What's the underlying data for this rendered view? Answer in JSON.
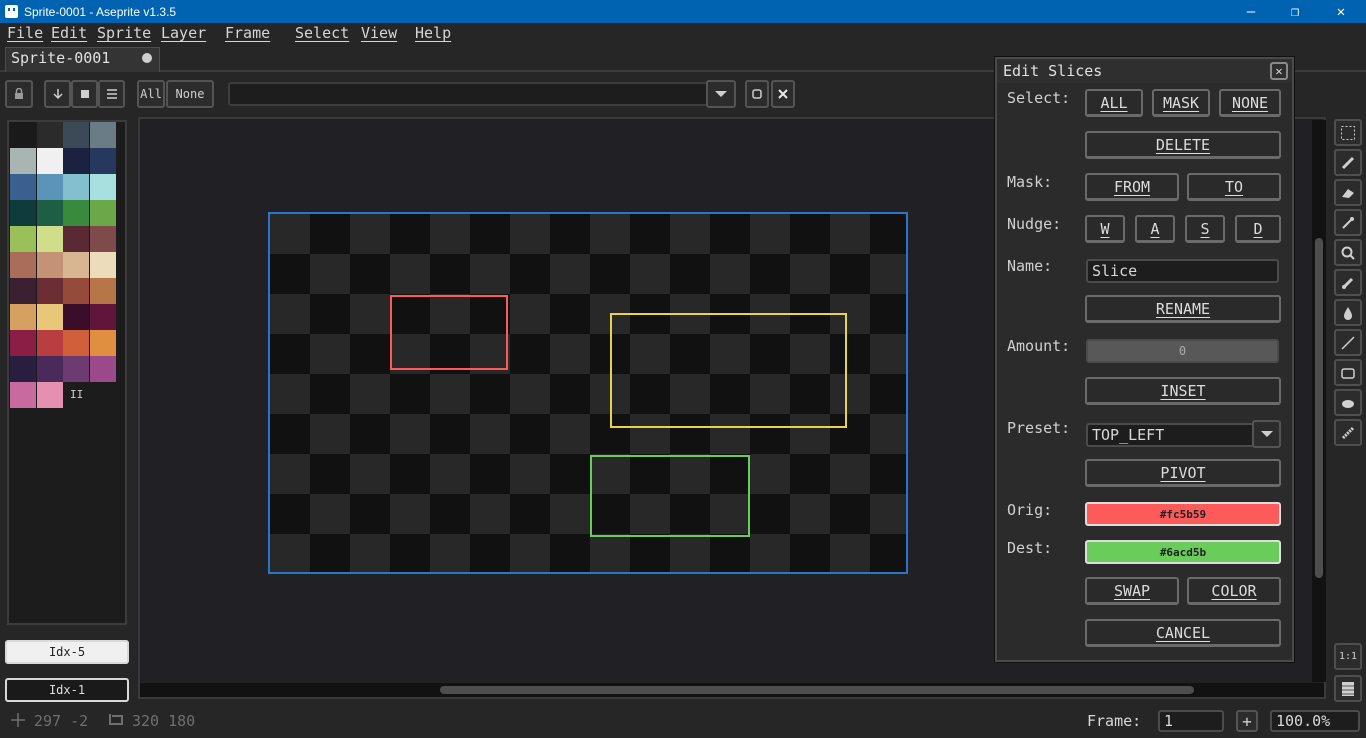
{
  "window": {
    "title": "Sprite-0001 - Aseprite v1.3.5",
    "minimize": "—",
    "restore": "❐",
    "close": "✕"
  },
  "menu": [
    "File",
    "Edit",
    "Sprite",
    "Layer",
    "Frame",
    "Select",
    "View",
    "Help"
  ],
  "tab": {
    "label": "Sprite-0001"
  },
  "toolbar": {
    "all_label": "All",
    "none_label": "None"
  },
  "palette": {
    "colors": [
      "#1a1a1a",
      "#2b2b2b",
      "#3b4a56",
      "#6a7c85",
      "#a8b5b2",
      "#f0f0f0",
      "#1b2240",
      "#27385f",
      "#3a6090",
      "#5a94b8",
      "#82c0d0",
      "#a8e0e0",
      "#0e3c3c",
      "#1e5e44",
      "#3a8a3e",
      "#6aa84a",
      "#9ac05a",
      "#d0de8a",
      "#5a2a34",
      "#7e4a4a",
      "#a86e5a",
      "#c49274",
      "#d8b692",
      "#ecdcbc",
      "#3a2030",
      "#6a2e34",
      "#964a3a",
      "#b67648",
      "#d6a060",
      "#e8c878",
      "#3a0e2a",
      "#60163a",
      "#8a1e44",
      "#b83e42",
      "#d0603a",
      "#e08e40",
      "#2a1e40",
      "#4a2a5a",
      "#6e3a72",
      "#9a4a8a",
      "#c86aa0",
      "#e690b0"
    ],
    "extra_marker": "II",
    "fg_label": "Idx-5",
    "bg_label": "Idx-1",
    "fg_color": "#f0f0f0",
    "bg_color": "#1a1a1a"
  },
  "slices": [
    {
      "name": "red",
      "color": "#fc5b59"
    },
    {
      "name": "yellow",
      "color": "#e8d34a"
    },
    {
      "name": "green",
      "color": "#6acd5b"
    }
  ],
  "dialog": {
    "title": "Edit Slices",
    "select_label": "Select:",
    "btn_all": "ALL",
    "btn_mask": "MASK",
    "btn_none": "NONE",
    "btn_delete": "DELETE",
    "mask_label": "Mask:",
    "btn_from": "FROM",
    "btn_to": "TO",
    "nudge_label": "Nudge:",
    "btn_w": "W",
    "btn_a": "A",
    "btn_s": "S",
    "btn_d": "D",
    "name_label": "Name:",
    "name_value": "Slice",
    "btn_rename": "RENAME",
    "amount_label": "Amount:",
    "amount_value": "0",
    "btn_inset": "INSET",
    "preset_label": "Preset:",
    "preset_value": "TOP_LEFT",
    "btn_pivot": "PIVOT",
    "orig_label": "Orig:",
    "orig_color": "#fc5b59",
    "dest_label": "Dest:",
    "dest_color": "#6acd5b",
    "btn_swap": "SWAP",
    "btn_color": "COLOR",
    "btn_cancel": "CANCEL"
  },
  "status": {
    "cursor": "297 -2",
    "size": "320 180",
    "frame_label": "Frame:",
    "frame_value": "1",
    "frame_add": "+",
    "zoom": "100.0%"
  }
}
